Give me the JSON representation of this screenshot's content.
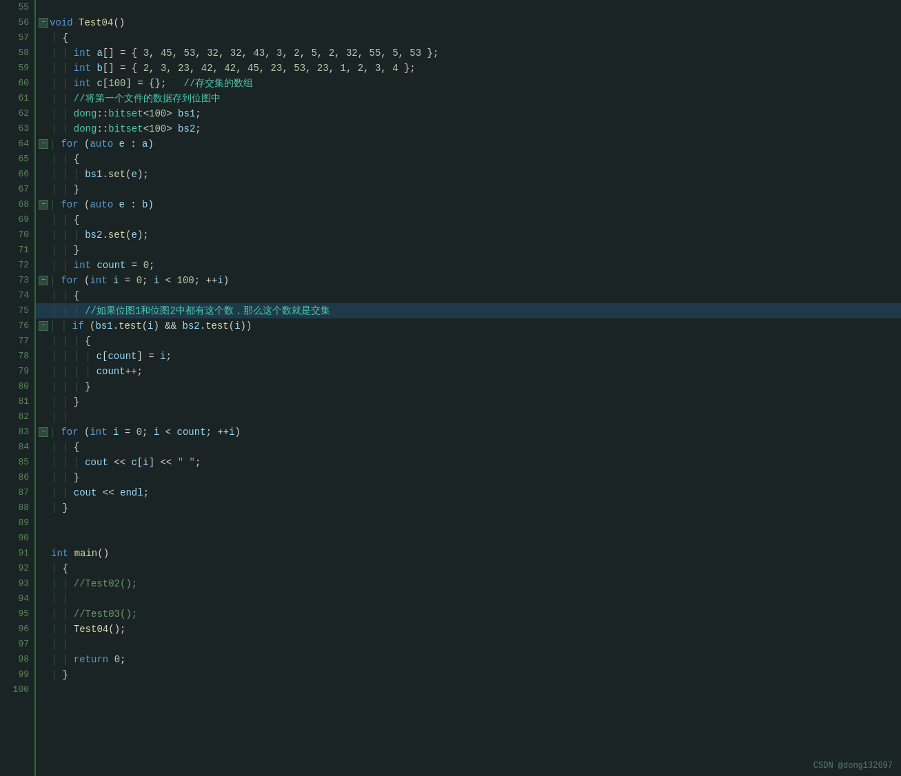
{
  "editor": {
    "background": "#1a2424",
    "accent": "#2a6a3a",
    "highlighted_line": 75,
    "watermark": "CSDN @dong132697",
    "lines": [
      {
        "num": 55,
        "content": "",
        "tokens": []
      },
      {
        "num": 56,
        "content": "void Test04()",
        "fold": true
      },
      {
        "num": 57,
        "content": "{"
      },
      {
        "num": 58,
        "content": "    int a[] = { 3, 45, 53, 32, 32, 43, 3, 2, 5, 2, 32, 55, 5, 53 };"
      },
      {
        "num": 59,
        "content": "    int b[] = { 2, 3, 23, 42, 42, 45, 23, 53, 23, 1, 2, 3, 4 };"
      },
      {
        "num": 60,
        "content": "    int c[100] = {};   //存交集的数组"
      },
      {
        "num": 61,
        "content": "    //将第一个文件的数据存到位图中"
      },
      {
        "num": 62,
        "content": "    dong::bitset<100> bs1;"
      },
      {
        "num": 63,
        "content": "    dong::bitset<100> bs2;"
      },
      {
        "num": 64,
        "content": "    for (auto e : a)",
        "fold": true
      },
      {
        "num": 65,
        "content": "    {"
      },
      {
        "num": 66,
        "content": "        bs1.set(e);"
      },
      {
        "num": 67,
        "content": "    }"
      },
      {
        "num": 68,
        "content": "    for (auto e : b)",
        "fold": true
      },
      {
        "num": 69,
        "content": "    {"
      },
      {
        "num": 70,
        "content": "        bs2.set(e);"
      },
      {
        "num": 71,
        "content": "    }"
      },
      {
        "num": 72,
        "content": "    int count = 0;"
      },
      {
        "num": 73,
        "content": "    for (int i = 0; i < 100; ++i)",
        "fold": true
      },
      {
        "num": 74,
        "content": "    {"
      },
      {
        "num": 75,
        "content": "        //如果位图1和位图2中都有这个数，那么这个数就是交集",
        "highlight": true
      },
      {
        "num": 76,
        "content": "        if (bs1.test(i) && bs2.test(i))",
        "fold": true
      },
      {
        "num": 77,
        "content": "        {"
      },
      {
        "num": 78,
        "content": "            c[count] = i;"
      },
      {
        "num": 79,
        "content": "            count++;"
      },
      {
        "num": 80,
        "content": "        }"
      },
      {
        "num": 81,
        "content": "    }"
      },
      {
        "num": 82,
        "content": ""
      },
      {
        "num": 83,
        "content": "    for (int i = 0; i < count; ++i)",
        "fold": true
      },
      {
        "num": 84,
        "content": "    {"
      },
      {
        "num": 85,
        "content": "        cout << c[i] << \" \";"
      },
      {
        "num": 86,
        "content": "    }"
      },
      {
        "num": 87,
        "content": "    cout << endl;"
      },
      {
        "num": 88,
        "content": "}"
      },
      {
        "num": 89,
        "content": ""
      },
      {
        "num": 90,
        "content": ""
      },
      {
        "num": 91,
        "content": "int main()"
      },
      {
        "num": 92,
        "content": "{"
      },
      {
        "num": 93,
        "content": "    //Test02();"
      },
      {
        "num": 94,
        "content": ""
      },
      {
        "num": 95,
        "content": "    //Test03();"
      },
      {
        "num": 96,
        "content": "    Test04();"
      },
      {
        "num": 97,
        "content": ""
      },
      {
        "num": 98,
        "content": "    return 0;"
      },
      {
        "num": 99,
        "content": "}"
      },
      {
        "num": 100,
        "content": ""
      }
    ]
  }
}
